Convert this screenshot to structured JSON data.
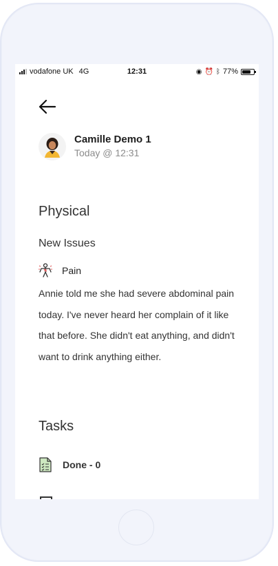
{
  "status_bar": {
    "carrier": "vodafone UK",
    "network": "4G",
    "time": "12:31",
    "battery_percent": "77%",
    "battery_level": 0.77
  },
  "header": {
    "back_icon": "arrow-left-icon",
    "author_name": "Camille Demo 1",
    "timestamp": "Today @ 12:31"
  },
  "physical": {
    "section_title": "Physical",
    "subsection_title": "New Issues",
    "issue": {
      "icon": "body-pain-icon",
      "label": "Pain",
      "note": "Annie told me she had severe abdominal pain today. I've never heard her complain of it like that before. She didn't eat anything, and didn't want to drink anything either."
    }
  },
  "tasks": {
    "section_title": "Tasks",
    "done_label": "Done - 0",
    "done_icon": "checklist-document-icon"
  },
  "colors": {
    "phone_frame": "#f2f4fb",
    "text_dark": "#333333",
    "text_muted": "#8b8b8b",
    "icon_green": "#cde8c0"
  }
}
